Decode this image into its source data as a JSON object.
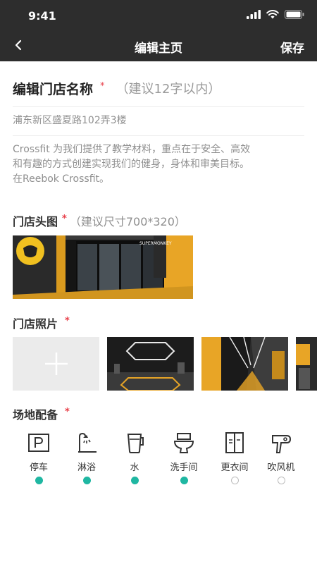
{
  "status_bar": {
    "time": "9:41"
  },
  "nav": {
    "title": "编辑主页",
    "save_label": "保存"
  },
  "store": {
    "name_label": "编辑门店名称",
    "required_mark": "*",
    "name_hint": "（建议12字以内）",
    "address": "浦东新区盛夏路102弄3楼",
    "description_lines": [
      "Crossfit 为我们提供了教学材料，重点在于安全、高效",
      "和有趣的方式创建实现我们的健身，身体和审美目标。",
      "在Reebok Crossfit。"
    ]
  },
  "cover": {
    "label": "门店头图",
    "required_mark": "*",
    "hint": "（建议尺寸700*320）",
    "sign_text": "SUPERMONKEY"
  },
  "photos": {
    "label": "门店照片",
    "required_mark": "*"
  },
  "facilities": {
    "label": "场地配备",
    "required_mark": "*",
    "items": [
      {
        "label": "停车",
        "icon": "parking-icon",
        "selected": true
      },
      {
        "label": "淋浴",
        "icon": "shower-icon",
        "selected": true
      },
      {
        "label": "水",
        "icon": "water-bottle-icon",
        "selected": true
      },
      {
        "label": "洗手间",
        "icon": "toilet-icon",
        "selected": true
      },
      {
        "label": "更衣间",
        "icon": "locker-room-icon",
        "selected": false
      },
      {
        "label": "吹风机",
        "icon": "hair-dryer-icon",
        "selected": false
      }
    ]
  },
  "colors": {
    "header_bg": "#2d2d2d",
    "accent_teal": "#1fb7a2",
    "required_red": "#e8414b",
    "gym_yellow": "#e8a526"
  }
}
